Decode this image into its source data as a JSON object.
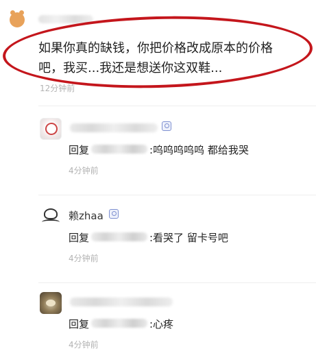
{
  "main_comment": {
    "text_line1": "如果你真的缺钱，你把价格改成原本的价格",
    "text_line2": "吧，我买...我还是想送你这双鞋...",
    "time": "12分钟前"
  },
  "replies": [
    {
      "username": "",
      "reply_prefix": "回复",
      "content": ":呜呜呜呜呜 都给我哭",
      "time": "4分钟前"
    },
    {
      "username": "赖zhaa",
      "reply_prefix": "回复",
      "content": ":看哭了 留卡号吧",
      "time": "4分钟前"
    },
    {
      "username": "",
      "reply_prefix": "回复",
      "content": ":心疼",
      "time": "4分钟前"
    }
  ],
  "colors": {
    "annotation_circle": "#c4161c",
    "timestamp": "#b3b3b3",
    "vip_badge": "#7d8fd0"
  }
}
